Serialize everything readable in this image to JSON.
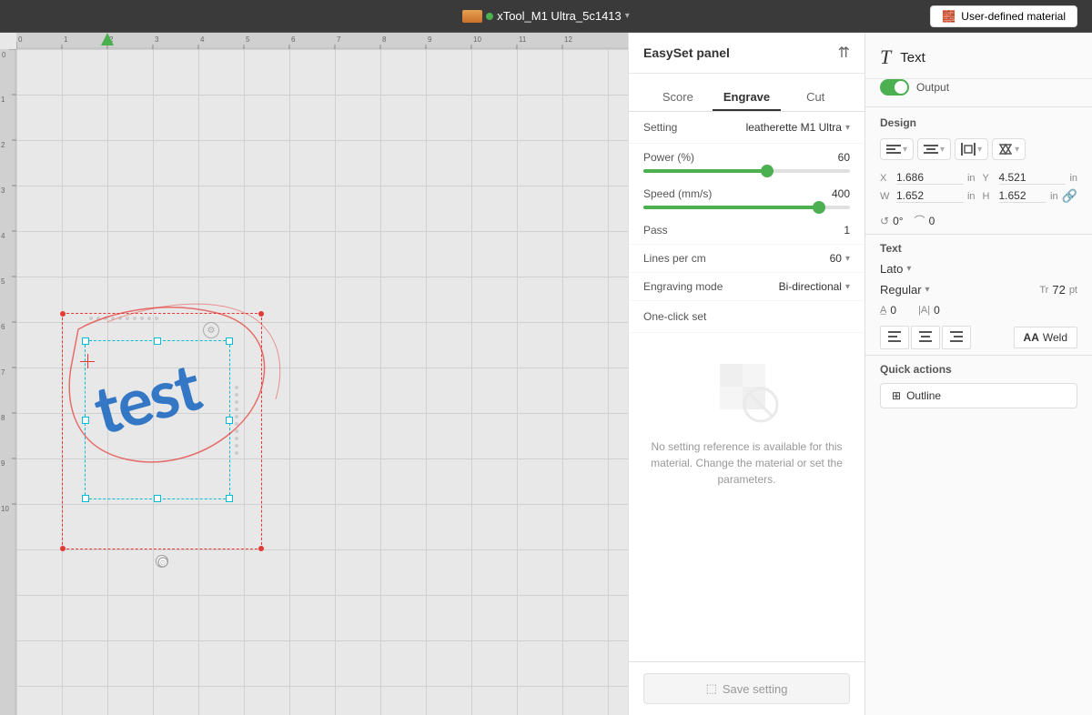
{
  "header": {
    "device_icon": "usb-device",
    "device_dot": "green",
    "device_name": "xTool_M1 Ultra_5c1413",
    "material_btn": "User-defined material"
  },
  "easyset": {
    "title": "EasySet panel",
    "tabs": [
      "Score",
      "Engrave",
      "Cut"
    ],
    "active_tab": "Engrave",
    "setting_label": "Setting",
    "setting_value": "leatherette M1 Ultra",
    "power_label": "Power (%)",
    "power_value": "60",
    "power_percent": 60,
    "speed_label": "Speed (mm/s)",
    "speed_value": "400",
    "speed_percent": 85,
    "pass_label": "Pass",
    "pass_value": "1",
    "lines_label": "Lines per cm",
    "lines_value": "60",
    "mode_label": "Engraving mode",
    "mode_value": "Bi-directional",
    "oneclick_label": "One-click set",
    "no_ref_text": "No setting reference is available for this material. Change the material or set the parameters.",
    "save_btn": "Save setting"
  },
  "right_panel": {
    "element_type": "Text",
    "output_label": "Output",
    "design_section": "Design",
    "x_label": "X",
    "x_value": "1.686",
    "y_label": "Y",
    "y_value": "4.521",
    "w_label": "W",
    "w_value": "1.652",
    "h_label": "H",
    "h_value": "1.652",
    "unit": "in",
    "rotation_value": "0°",
    "corner_value": "0",
    "text_section": "Text",
    "font_name": "Lato",
    "font_style": "Regular",
    "font_size_label": "Tr",
    "font_size_value": "72",
    "font_size_unit": "pt",
    "char_spacing_label": "A̲",
    "char_spacing_value": "0",
    "line_spacing_label": "|A|",
    "line_spacing_value": "0",
    "quick_actions": "Quick actions",
    "outline_btn": "Outline",
    "weld_btn": "Weld"
  },
  "align_icons": {
    "left": "≡",
    "center": "≡",
    "right": "≡"
  }
}
